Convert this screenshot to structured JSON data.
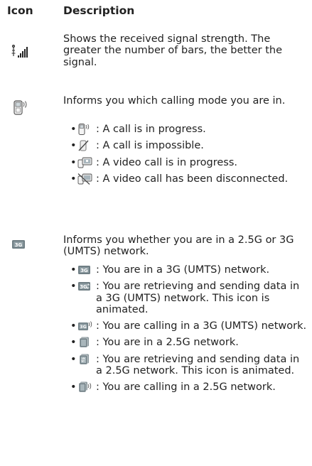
{
  "header": {
    "icon": "Icon",
    "description": "Description"
  },
  "rows": [
    {
      "icon": "signal-strength-icon",
      "text": "Shows the received signal strength. The greater the number of bars, the better the signal.",
      "bullets": []
    },
    {
      "icon": "calling-mode-icon",
      "text": "Informs you which calling mode you are in.",
      "bullets": [
        {
          "icon": "call-in-progress-icon",
          "text": ": A call is in progress."
        },
        {
          "icon": "call-impossible-icon",
          "text": ": A call is impossible."
        },
        {
          "icon": "video-call-in-progress-icon",
          "text": ": A video call is in progress."
        },
        {
          "icon": "video-call-disconnected-icon",
          "text": ": A video call has been disconnected."
        }
      ]
    },
    {
      "icon": "network-type-icon",
      "text": "Informs you whether you are in a 2.5G or 3G (UMTS) network.",
      "bullets": [
        {
          "icon": "3g-network-icon",
          "text": ": You are in a 3G (UMTS) network."
        },
        {
          "icon": "3g-data-icon",
          "text": ": You are retrieving and sending data in a 3G (UMTS) network. This icon is animated."
        },
        {
          "icon": "3g-calling-icon",
          "text": ": You are calling in a 3G (UMTS) network."
        },
        {
          "icon": "2-5g-network-icon",
          "text": ": You are in a 2.5G network."
        },
        {
          "icon": "2-5g-data-icon",
          "text": ": You are retrieving and sending data in a 2.5G network. This icon is animated."
        },
        {
          "icon": "2-5g-calling-icon",
          "text": ": You are calling in a 2.5G network."
        }
      ]
    }
  ],
  "bullet_char": "•"
}
